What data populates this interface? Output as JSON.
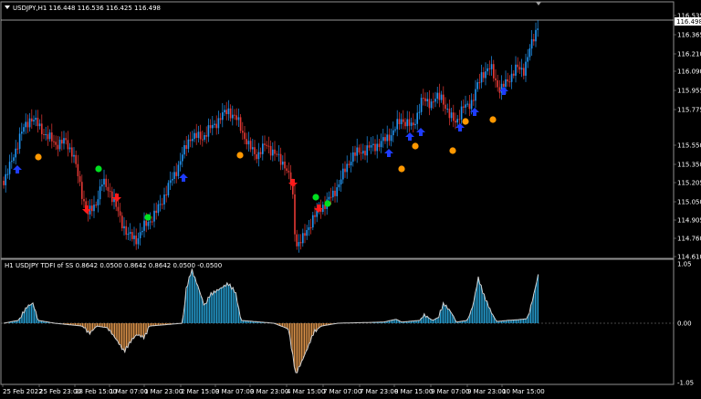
{
  "main_panel": {
    "title": "USDJPY,H1  116.448 116.536 116.425 116.498",
    "price_labels": [
      "116.535",
      "116.365",
      "116.210",
      "116.090",
      "115.955",
      "115.775",
      "115.550",
      "115.350",
      "115.205",
      "115.050",
      "114.905",
      "114.760",
      "114.610"
    ],
    "current_price": "116.498"
  },
  "indicator_panel": {
    "title": "H1 USDJPY TDFI of SS 0.8642 0.0500 0.8642 0.8642 0.0500 -0.0500",
    "scale_labels": [
      "1.05",
      "0.00",
      "-1.05"
    ]
  },
  "time_axis": {
    "labels": [
      "25 Feb 2022",
      "25 Feb 23:00",
      "28 Feb 15:00",
      "1 Mar 07:00",
      "1 Mar 23:00",
      "2 Mar 15:00",
      "3 Mar 07:00",
      "3 Mar 23:00",
      "4 Mar 15:00",
      "7 Mar 07:00",
      "7 Mar 23:00",
      "8 Mar 15:00",
      "9 Mar 07:00",
      "9 Mar 23:00",
      "10 Mar 15:00"
    ]
  },
  "colors": {
    "background": "#000000",
    "bull": "#2196f3",
    "bear": "#e53935",
    "histogram_positive": "#29a9e0",
    "histogram_negative": "#f0a050",
    "dot_orange": "#ff9800",
    "dot_green": "#00e020",
    "arrow_blue": "#1e3cff",
    "arrow_red": "#ff1a1a"
  },
  "icons": {
    "menu_toggle": "triangle-down-icon",
    "buy_signal": "arrow-up-icon",
    "sell_signal": "arrow-down-icon",
    "signal_dot": "circle-icon"
  }
}
